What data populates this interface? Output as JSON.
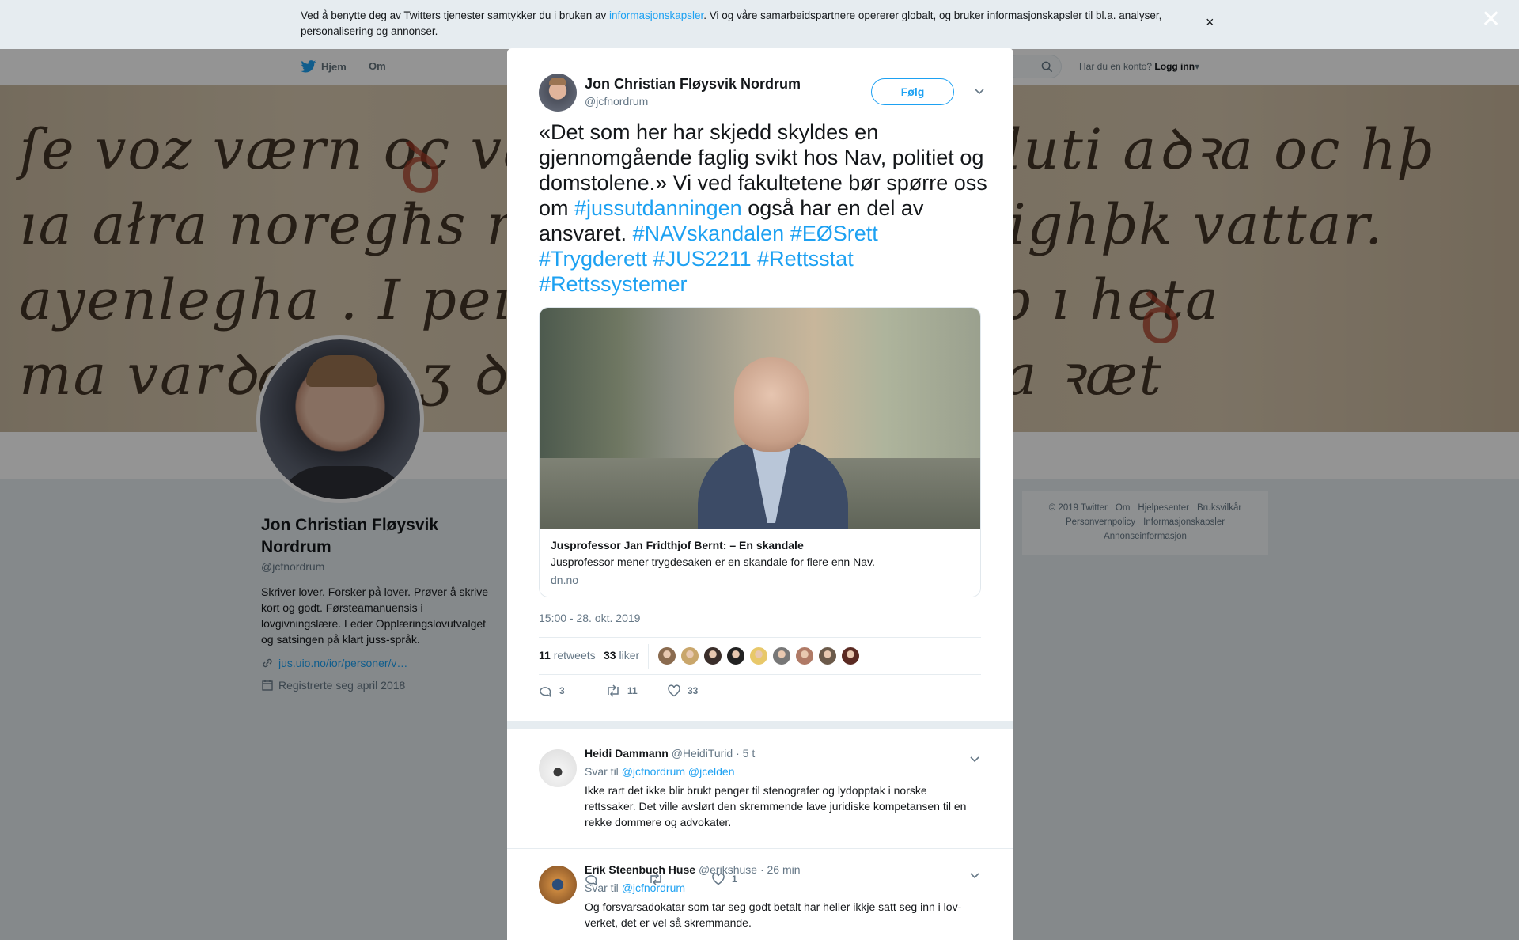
{
  "cookie": {
    "text_before": "Ved å benytte deg av Twitters tjenester samtykker du i bruken av ",
    "link": "informasjonskapsler",
    "text_after": ". Vi og våre samarbeidspartnere opererer globalt, og bruker informasjonskapsler til bl.a. analyser, personalisering og annonser.",
    "close": "×"
  },
  "modal_close": "✕",
  "nav": {
    "home": "Hjem",
    "about": "Om",
    "account_prompt": "Har du en konto?",
    "login": "Logg inn"
  },
  "profile": {
    "name": "Jon Christian Fløysvik Nordrum",
    "handle": "@jcfnordrum",
    "bio": "Skriver lover. Forsker på lover. Prøver å skrive kort og godt. Førsteamanuensis i lovgivningslære. Leder Opplæringslovutvalget og satsingen på klart juss-språk.",
    "link": "jus.uio.no/ior/personer/v…",
    "joined": "Registrerte seg april 2018"
  },
  "footer": {
    "items": [
      "© 2019 Twitter",
      "Om",
      "Hjelpesenter",
      "Bruksvilkår",
      "Personvernpolicy",
      "Informasjonskapsler",
      "Annonseinformasjon"
    ]
  },
  "tweet": {
    "author_name": "Jon Christian Fløysvik Nordrum",
    "author_handle": "@jcfnordrum",
    "follow_label": "Følg",
    "text_1": "«Det som her har skjedd skyldes en gjennomgående faglig svikt hos Nav, politiet og domstolene.» Vi ved fakultetene bør spørre oss om ",
    "hashtag_1": "#jussutdanningen",
    "text_2": " også har en del av ansvaret. ",
    "hashtags_2": "#NAVskandalen #EØSrett #Trygderett #JUS2211 #Rettsstat #Rettssystemer",
    "card": {
      "title": "Jusprofessor Jan Fridthjof Bernt: – En skandale",
      "description": "Jusprofessor mener trygdesaken er en skandale for flere enn Nav.",
      "domain": "dn.no"
    },
    "timestamp": "15:00 - 28. okt. 2019",
    "retweets_count": "11",
    "retweets_label": "retweets",
    "likes_count": "33",
    "likes_label": "liker",
    "action_replies": "3",
    "action_retweets": "11",
    "action_likes": "33"
  },
  "likers_colors": [
    "#8a6b4f",
    "#c9a66b",
    "#3a2e2a",
    "#222222",
    "#e8c86a",
    "#777777",
    "#b07a66",
    "#6b5a4a",
    "#5a2a22"
  ],
  "replies": [
    {
      "name": "Heidi Dammann",
      "handle": "@HeidiTurid",
      "time": "· 5 t",
      "reply_to_label": "Svar til ",
      "mentions": "@jcfnordrum @jcelden",
      "text": "Ikke rart det ikke blir brukt penger til stenografer og lydopptak i norske rettssaker. Det ville avslørt den skremmende lave juridiske kompetansen til en rekke dommere og advokater.",
      "likes": "1"
    },
    {
      "name": "Erik Steenbuch Huse",
      "handle": "@erikshuse",
      "time": "· 26 min",
      "reply_to_label": "Svar til ",
      "mentions": "@jcfnordrum",
      "text": "Og forsvarsadokatar som tar seg godt betalt har heller ikkje satt seg inn i lov-verket, det er vel så skremmande."
    }
  ],
  "colors": {
    "accent": "#1da1f2",
    "text": "#14171a",
    "muted": "#657786"
  }
}
